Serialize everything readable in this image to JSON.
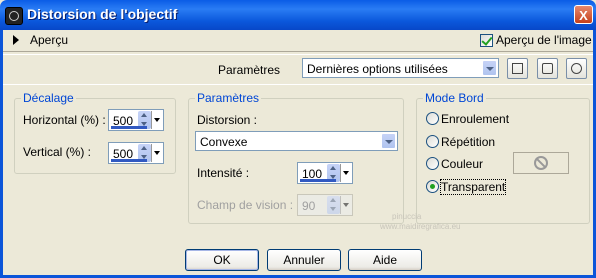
{
  "window": {
    "title": "Distorsion de l'objectif",
    "close_glyph": "X"
  },
  "preview_bar": {
    "expand_label": "Aperçu",
    "preview_on_image_label": "Aperçu de l'image",
    "preview_on_image_checked": true
  },
  "presets": {
    "label": "Paramètres",
    "selected": "Dernières options utilisées",
    "tools": [
      "save-preset-icon",
      "randomize-icon",
      "reset-icon"
    ]
  },
  "decalage": {
    "title": "Décalage",
    "horizontal_label": "Horizontal (%) :",
    "horizontal_value": "500",
    "vertical_label": "Vertical (%) :",
    "vertical_value": "500"
  },
  "parametres": {
    "title": "Paramètres",
    "distortion_label": "Distorsion :",
    "distortion_value": "Convexe",
    "intensity_label": "Intensité :",
    "intensity_value": "100",
    "fov_label": "Champ de vision :",
    "fov_value": "90"
  },
  "mode_bord": {
    "title": "Mode Bord",
    "options": [
      "Enroulement",
      "Répétition",
      "Couleur",
      "Transparent"
    ],
    "selected": "Transparent"
  },
  "buttons": {
    "ok": "OK",
    "cancel": "Annuler",
    "help": "Aide"
  },
  "watermark": {
    "line1": "pinuccia",
    "line2": "www.maidiregrafica.eu"
  }
}
